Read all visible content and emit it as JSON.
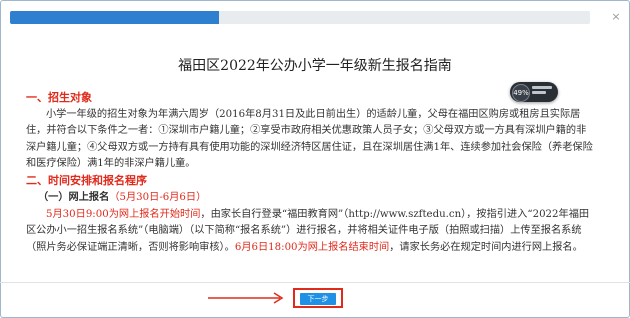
{
  "progress": {
    "fraction": 0.36
  },
  "dialog": {
    "close_label": "×",
    "title": "福田区2022年公办小学一年级新生报名指南"
  },
  "section1": {
    "heading": "一、招生对象",
    "body": "小学一年级的招生对象为年满六周岁（2016年8月31日及此日前出生）的适龄儿童，父母在福田区购房或租房且实际居住，并符合以下条件之一者：①深圳市户籍儿童；②享受市政府相关优惠政策人员子女；③父母双方或一方具有深圳户籍的非深户籍儿童；④父母双方或一方持有具有使用功能的深圳经济特区居住证，且在深圳居住满1年、连续参加社会保险（养老保险和医疗保险）满1年的非深户籍儿童。"
  },
  "section2": {
    "heading": "二、时间安排和报名程序",
    "sub_heading": "（一）网上报名",
    "sub_date": "（5月30日-6月6日）",
    "p_red1": "5月30日9:00为网上报名开始时间",
    "p_text1": "，由家长自行登录“福田教育网”（http://www.szftedu.cn），按指引进入“2022年福田区公办小一招生报名系统”（电脑端）（以下简称“报名系统”）进行报名，并将相关证件电子版（拍照或扫描）上传至报名系统（照片务必保证端正清晰，否则将影响审核）。",
    "p_red2": "6月6日18:00为网上报名结束时间",
    "p_text2": "，请家长务必在规定时间内进行网上报名。"
  },
  "badge": {
    "percent": "49%"
  },
  "footer": {
    "next_label": "下一步"
  },
  "colors": {
    "accent": "#2f7fd0",
    "heading_red": "#e02a1c",
    "button_blue": "#1e90e6",
    "highlight_border": "#e02a1c"
  }
}
